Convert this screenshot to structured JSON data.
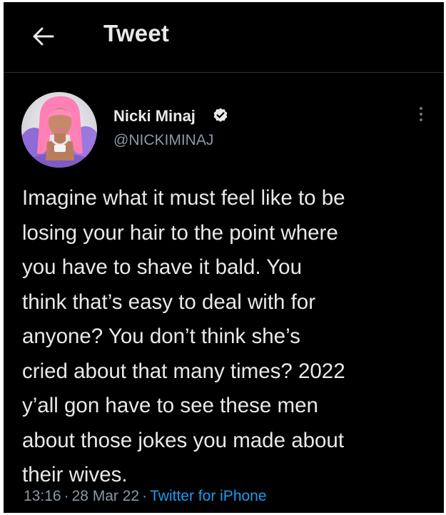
{
  "header": {
    "back_icon": "arrow-left-icon",
    "title": "Tweet"
  },
  "author": {
    "name": "Nicki Minaj",
    "handle": "@NICKIMINAJ",
    "verified_icon": "verified-badge-icon",
    "verified_color": "#e7e9ea",
    "avatar_icon": "profile-avatar"
  },
  "more_icon": "more-vertical-icon",
  "tweet": {
    "lines": [
      "Imagine what it must feel like to be",
      "losing your hair to the point where",
      "you have to shave it bald. You",
      "think that’s easy to deal with for",
      "anyone? You don’t think she’s",
      "cried about that many times? 2022",
      "y’all gon have to see these men",
      "about those jokes you made about",
      "their wives."
    ]
  },
  "meta": {
    "time": "13:16",
    "separator": "·",
    "date": "28 Mar 22",
    "source": "Twitter for iPhone"
  },
  "colors": {
    "background": "#000000",
    "text_primary": "#e7e9ea",
    "text_secondary": "#8b98a5",
    "link": "#1d9bf0",
    "divider": "#2f3336"
  }
}
